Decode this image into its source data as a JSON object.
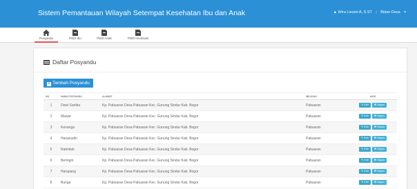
{
  "app": {
    "title": "Sistem Pemantauan Wilayah Setempat Kesehatan Ibu dan Anak"
  },
  "user": {
    "name": "Wira Lieomi A, S.ST",
    "role_menu": "Bidan Desa"
  },
  "nav": {
    "items": [
      {
        "label": "Posyandu",
        "icon": "home-icon"
      },
      {
        "label": "PWS Ibu",
        "icon": "document-icon"
      },
      {
        "label": "PWS Anak",
        "icon": "document-icon"
      },
      {
        "label": "PWS Imunisasi",
        "icon": "document-icon"
      }
    ]
  },
  "panel": {
    "title": "Daftar Posyandu",
    "add_button": "Tambah Posyandu"
  },
  "table": {
    "headers": {
      "no": "NO.",
      "nama": "NAMA POSYANDU",
      "alamat": "ALAMAT",
      "wilayah": "WILAYAH",
      "aksi": "AKSI"
    },
    "edit_label": "Edit",
    "hapus_label": "Hapus",
    "rows": [
      {
        "no": "1",
        "nama": "Dewi Sartika",
        "alamat": "Kp. Pabuaran Desa Pabuaran Kec. Gunung Sindur Kab. Bogor",
        "wilayah": "Pabuaran"
      },
      {
        "no": "2",
        "nama": "Mawar",
        "alamat": "Kp. Pabuaran Desa Pabuaran Kec. Gunung Sindur Kab. Bogor",
        "wilayah": "Pabuaran"
      },
      {
        "no": "3",
        "nama": "Kenanga",
        "alamat": "Kp. Pabuaran Desa Pabuaran Kec. Gunung Sindur Kab. Bogor",
        "wilayah": "Pabuaran"
      },
      {
        "no": "4",
        "nama": "Hasanudin",
        "alamat": "Kp. Pabuaran Desa Pabuaran Kec. Gunung Sindur Kab. Bogor",
        "wilayah": "Pabuaran"
      },
      {
        "no": "5",
        "nama": "Ratmilah",
        "alamat": "Kp. Pabuaran Desa Pabuaran Kec. Gunung Sindur Kab. Bogor",
        "wilayah": "Pabuaran"
      },
      {
        "no": "6",
        "nama": "Beringin",
        "alamat": "Kp. Pabuaran Desa Pabuaran Kec. Gunung Sindur Kab. Bogor",
        "wilayah": "Pabuaran"
      },
      {
        "no": "7",
        "nama": "Harapang",
        "alamat": "Kp. Pabuaran Desa Pabuaran Kec. Gunung Sindur Kab. Bogor",
        "wilayah": "Pabuaran"
      },
      {
        "no": "8",
        "nama": "Bunga",
        "alamat": "Kp. Pabuaran Desa Pabuaran Kec. Gunung Sindur Kab. Bogor",
        "wilayah": "Pabuaran"
      }
    ]
  },
  "colors": {
    "brand": "#2b90d6",
    "action": "#3ba7c9",
    "active_tab": "#e55353"
  }
}
